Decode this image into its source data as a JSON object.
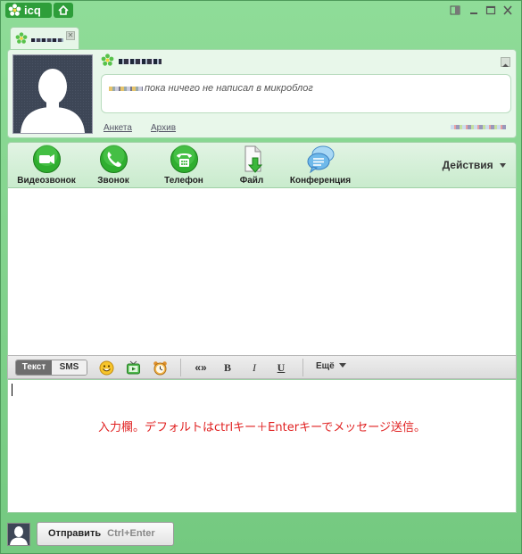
{
  "app": {
    "logo_text": "icq"
  },
  "window_controls": [
    "restore-icon",
    "minimize-icon",
    "maximize-icon",
    "close-icon"
  ],
  "profile": {
    "status_message": "пока ничего не написал в микроблог",
    "links": {
      "profile": "Анкета",
      "archive": "Архив"
    }
  },
  "toolbar": {
    "items": [
      {
        "label": "Видеозвонок",
        "icon": "video-call-icon"
      },
      {
        "label": "Звонок",
        "icon": "phone-call-icon"
      },
      {
        "label": "Телефон",
        "icon": "telephone-icon"
      },
      {
        "label": "Файл",
        "icon": "file-send-icon"
      },
      {
        "label": "Конференция",
        "icon": "conference-icon"
      }
    ],
    "actions_label": "Действия"
  },
  "format": {
    "mode_text": "Текст",
    "mode_sms": "SMS",
    "quote": "«»",
    "bold": "B",
    "italic": "I",
    "underline": "U",
    "more": "Ещё"
  },
  "input": {
    "note": "入力欄。デフォルトはctrlキー＋Enterキーでメッセージ送信。"
  },
  "send": {
    "label": "Отправить",
    "shortcut": "Ctrl+Enter"
  },
  "colors": {
    "accent": "#2e9e3a",
    "window_bg": "#7fcf8a",
    "note": "#e02020"
  }
}
